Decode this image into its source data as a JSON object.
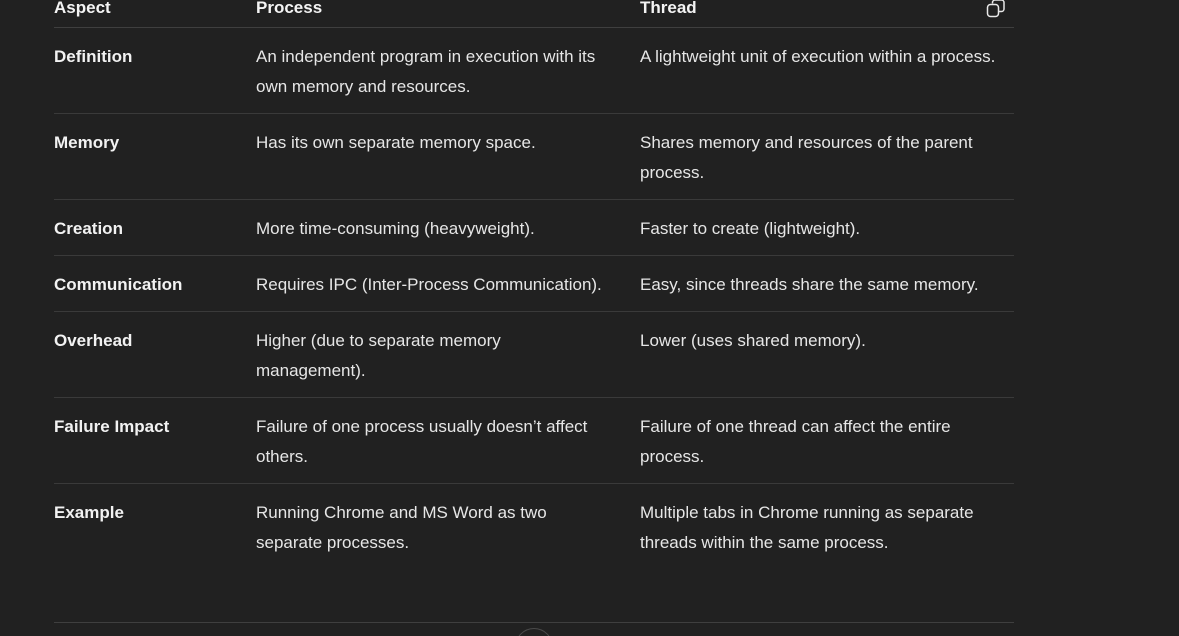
{
  "table": {
    "headers": {
      "aspect": "Aspect",
      "process": "Process",
      "thread": "Thread"
    },
    "rows": [
      {
        "aspect": "Definition",
        "process": "An independent program in execution with its own memory and resources.",
        "thread": "A lightweight unit of execution within a process."
      },
      {
        "aspect": "Memory",
        "process": "Has its own separate memory space.",
        "thread": "Shares memory and resources of the parent process."
      },
      {
        "aspect": "Creation",
        "process": "More time-consuming (heavyweight).",
        "thread": "Faster to create (lightweight)."
      },
      {
        "aspect": "Communication",
        "process": "Requires IPC (Inter-Process Communication).",
        "thread": "Easy, since threads share the same memory."
      },
      {
        "aspect": "Overhead",
        "process": "Higher (due to separate memory management).",
        "thread": "Lower (uses shared memory)."
      },
      {
        "aspect": "Failure Impact",
        "process": "Failure of one process usually doesn’t affect others.",
        "thread": "Failure of one thread can affect the entire process."
      },
      {
        "aspect": "Example",
        "process": "Running Chrome and MS Word as two separate processes.",
        "thread": "Multiple tabs in Chrome running as separate threads within the same process."
      }
    ]
  },
  "icons": {
    "copy": "copy-icon",
    "scroll": "scroll-down-icon"
  }
}
